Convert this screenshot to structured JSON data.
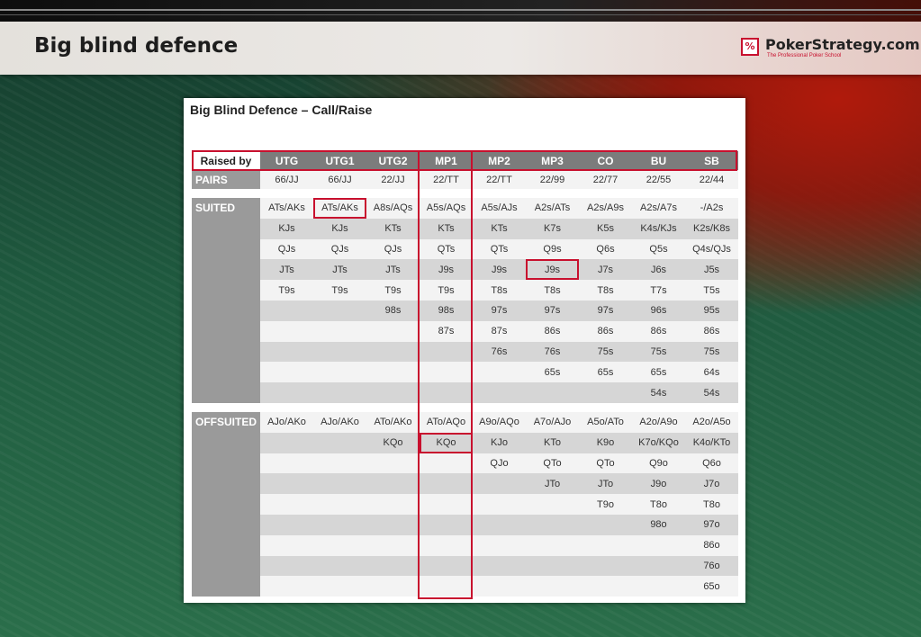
{
  "header": {
    "title": "Big blind defence"
  },
  "logo": {
    "name": "PokerStrategy.com",
    "tagline": "The Professional Poker School",
    "mark": "%"
  },
  "table_title": "Big Blind Defence – Call/Raise",
  "columns": [
    "Raised by",
    "UTG",
    "UTG1",
    "UTG2",
    "MP1",
    "MP2",
    "MP3",
    "CO",
    "BU",
    "SB"
  ],
  "pairs": {
    "label": "PAIRS",
    "cells": [
      "66/JJ",
      "66/JJ",
      "22/JJ",
      "22/TT",
      "22/TT",
      "22/99",
      "22/77",
      "22/55",
      "22/44"
    ]
  },
  "suited": {
    "label": "SUITED",
    "rows": [
      [
        "ATs/AKs",
        "ATs/AKs",
        "A8s/AQs",
        "A5s/AQs",
        "A5s/AJs",
        "A2s/ATs",
        "A2s/A9s",
        "A2s/A7s",
        "-/A2s"
      ],
      [
        "KJs",
        "KJs",
        "KTs",
        "KTs",
        "KTs",
        "K7s",
        "K5s",
        "K4s/KJs",
        "K2s/K8s"
      ],
      [
        "QJs",
        "QJs",
        "QJs",
        "QTs",
        "QTs",
        "Q9s",
        "Q6s",
        "Q5s",
        "Q4s/QJs"
      ],
      [
        "JTs",
        "JTs",
        "JTs",
        "J9s",
        "J9s",
        "J9s",
        "J7s",
        "J6s",
        "J5s"
      ],
      [
        "T9s",
        "T9s",
        "T9s",
        "T9s",
        "T8s",
        "T8s",
        "T8s",
        "T7s",
        "T5s"
      ],
      [
        "",
        "",
        "98s",
        "98s",
        "97s",
        "97s",
        "97s",
        "96s",
        "95s"
      ],
      [
        "",
        "",
        "",
        "87s",
        "87s",
        "86s",
        "86s",
        "86s",
        "86s"
      ],
      [
        "",
        "",
        "",
        "",
        "76s",
        "76s",
        "75s",
        "75s",
        "75s"
      ],
      [
        "",
        "",
        "",
        "",
        "",
        "65s",
        "65s",
        "65s",
        "64s"
      ],
      [
        "",
        "",
        "",
        "",
        "",
        "",
        "",
        "54s",
        "54s"
      ]
    ]
  },
  "offsuited": {
    "label": "OFFSUITED",
    "rows": [
      [
        "AJo/AKo",
        "AJo/AKo",
        "ATo/AKo",
        "ATo/AQo",
        "A9o/AQo",
        "A7o/AJo",
        "A5o/ATo",
        "A2o/A9o",
        "A2o/A5o"
      ],
      [
        "",
        "",
        "KQo",
        "KQo",
        "KJo",
        "KTo",
        "K9o",
        "K7o/KQo",
        "K4o/KTo"
      ],
      [
        "",
        "",
        "",
        "",
        "QJo",
        "QTo",
        "QTo",
        "Q9o",
        "Q6o"
      ],
      [
        "",
        "",
        "",
        "",
        "",
        "JTo",
        "JTo",
        "J9o",
        "J7o"
      ],
      [
        "",
        "",
        "",
        "",
        "",
        "",
        "T9o",
        "T8o",
        "T8o"
      ],
      [
        "",
        "",
        "",
        "",
        "",
        "",
        "",
        "98o",
        "97o"
      ],
      [
        "",
        "",
        "",
        "",
        "",
        "",
        "",
        "",
        "86o"
      ],
      [
        "",
        "",
        "",
        "",
        "",
        "",
        "",
        "",
        "76o"
      ],
      [
        "",
        "",
        "",
        "",
        "",
        "",
        "",
        "",
        "65o"
      ]
    ]
  },
  "highlights": {
    "color": "#c8102e",
    "boxed_cells": [
      {
        "section": "suited",
        "row": 0,
        "col": 1
      },
      {
        "section": "suited",
        "row": 3,
        "col": 5
      },
      {
        "section": "offsuited",
        "row": 1,
        "col": 3
      }
    ],
    "boxed_column": "MP1",
    "boxed_header_row": true
  }
}
